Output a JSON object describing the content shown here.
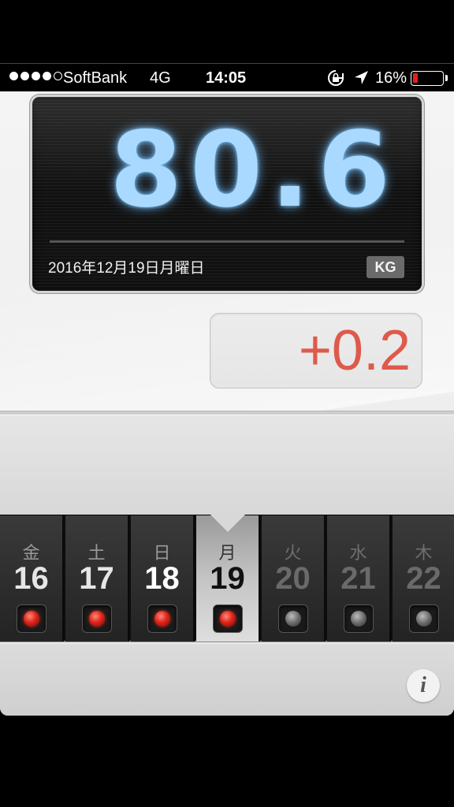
{
  "status_bar": {
    "carrier": "SoftBank",
    "network": "4G",
    "time": "14:05",
    "battery_percent": "16%",
    "battery_level": 0.16,
    "signal_bars_filled": 4,
    "signal_bars_total": 5,
    "icons": [
      "orientation-lock-icon",
      "location-arrow-icon",
      "battery-icon"
    ]
  },
  "display": {
    "weight": "80.6",
    "date": "2016年12月19日月曜日",
    "unit": "KG",
    "glow_color": "#a9d9ff"
  },
  "difference": {
    "value": "+0.2",
    "color": "#de5a4c"
  },
  "calendar": {
    "days": [
      {
        "dow": "金",
        "num": "16",
        "recorded": true
      },
      {
        "dow": "土",
        "num": "17",
        "recorded": true
      },
      {
        "dow": "日",
        "num": "18",
        "recorded": true
      },
      {
        "dow": "月",
        "num": "19",
        "recorded": true,
        "selected": true
      },
      {
        "dow": "火",
        "num": "20",
        "recorded": false
      },
      {
        "dow": "水",
        "num": "21",
        "recorded": false
      },
      {
        "dow": "木",
        "num": "22",
        "recorded": false
      }
    ]
  },
  "info_button": {
    "label": "i",
    "icon": "info-icon"
  }
}
